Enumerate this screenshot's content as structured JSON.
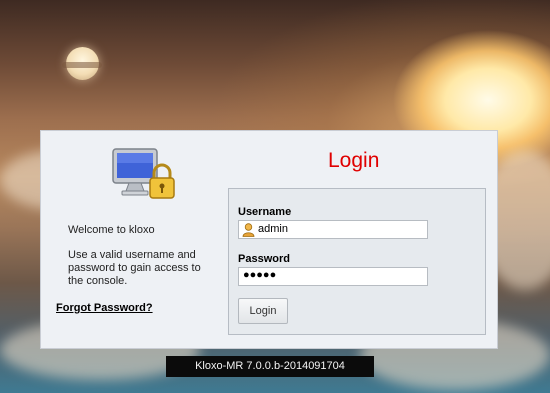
{
  "panel": {
    "welcome": "Welcome to kloxo",
    "instructions": "Use a valid username and password to gain access to the console.",
    "forgot_password": "Forgot Password?",
    "title": "Login"
  },
  "form": {
    "username_label": "Username",
    "username_value": "admin",
    "password_label": "Password",
    "password_value": "●●●●●",
    "login_button": "Login"
  },
  "footer": {
    "version": "Kloxo-MR 7.0.0.b-2014091704"
  },
  "colors": {
    "title": "#e00000",
    "panel_bg": "#eef1f5",
    "form_bg": "#e6eaee"
  },
  "icons": [
    "monitor-lock-icon",
    "user-icon"
  ]
}
